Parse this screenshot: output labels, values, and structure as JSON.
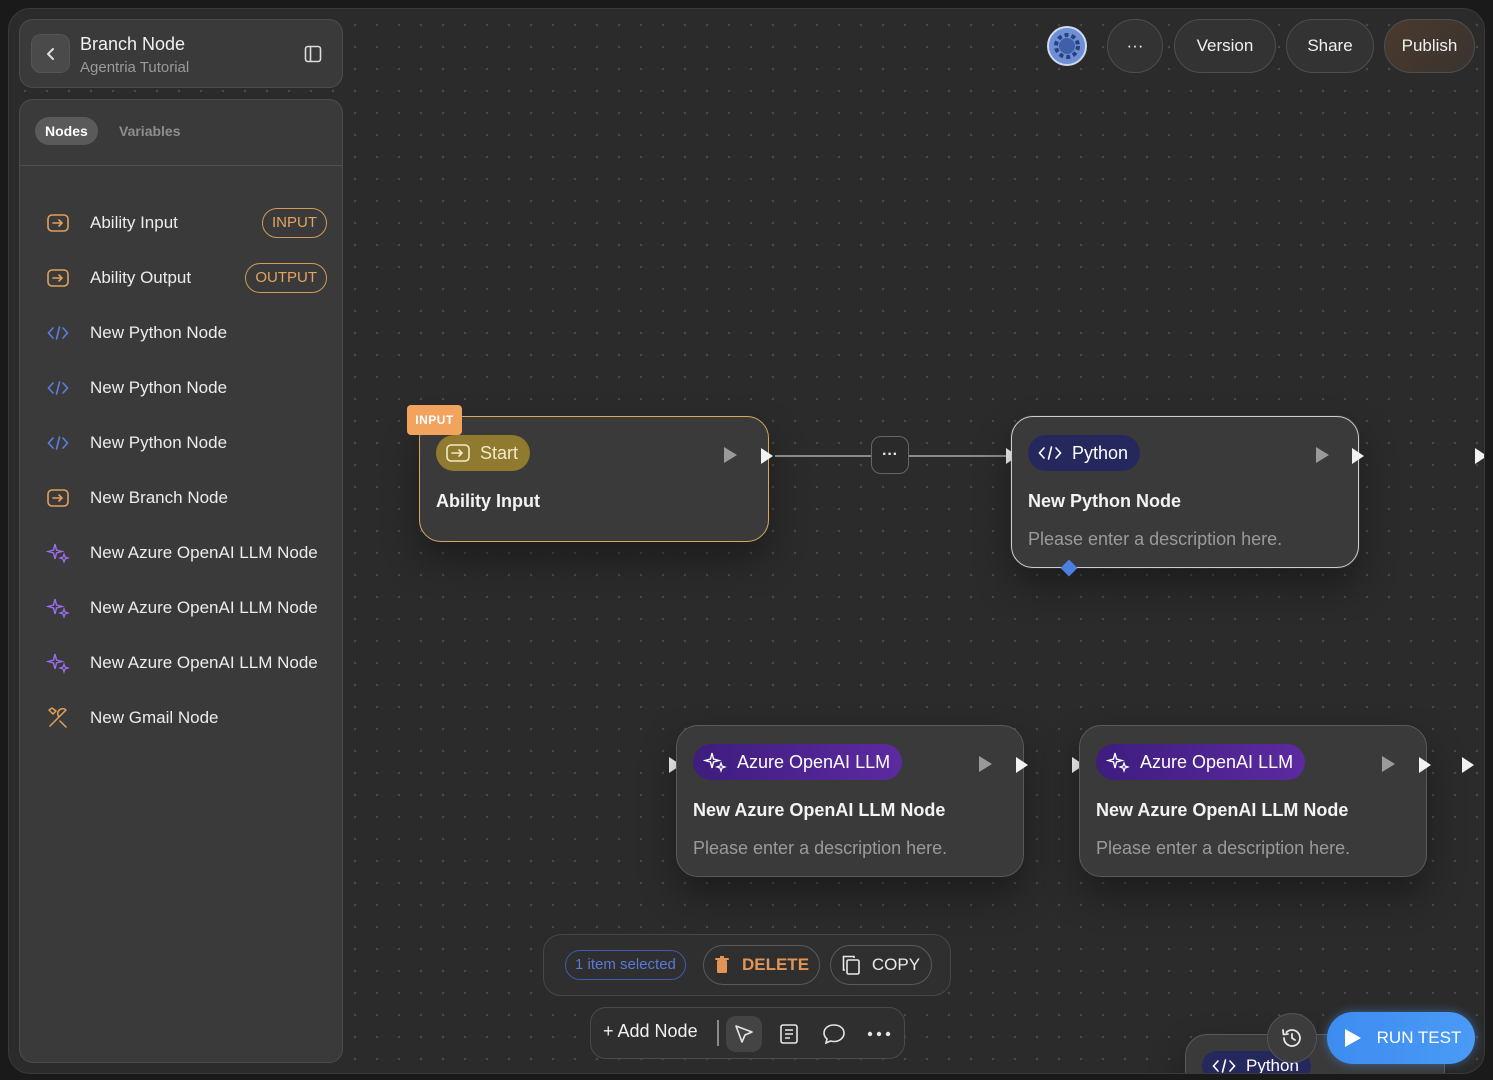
{
  "header": {
    "title": "Branch Node",
    "subtitle": "Agentria Tutorial"
  },
  "sidebar": {
    "tabs": [
      {
        "label": "Nodes",
        "active": true
      },
      {
        "label": "Variables",
        "active": false
      }
    ],
    "items": [
      {
        "label": "Ability Input",
        "icon": "input-icon",
        "tag": "INPUT"
      },
      {
        "label": "Ability Output",
        "icon": "output-icon",
        "tag": "OUTPUT"
      },
      {
        "label": "New Python Node",
        "icon": "code-icon"
      },
      {
        "label": "New Python Node",
        "icon": "code-icon"
      },
      {
        "label": "New Python Node",
        "icon": "code-icon"
      },
      {
        "label": "New Branch Node",
        "icon": "branch-icon"
      },
      {
        "label": "New Azure OpenAI LLM Node",
        "icon": "sparkle-icon"
      },
      {
        "label": "New Azure OpenAI LLM Node",
        "icon": "sparkle-icon"
      },
      {
        "label": "New Azure OpenAI LLM Node",
        "icon": "sparkle-icon"
      },
      {
        "label": "New Gmail Node",
        "icon": "tools-icon"
      }
    ]
  },
  "toolbar": {
    "more": "···",
    "version": "Version",
    "share": "Share",
    "publish": "Publish"
  },
  "canvas": {
    "start_node": {
      "badge": "INPUT",
      "pill": "Start",
      "title": "Ability Input"
    },
    "python_node": {
      "pill": "Python",
      "title": "New Python Node",
      "description": "Please enter a description here."
    },
    "llm_nodes": [
      {
        "pill": "Azure OpenAI LLM",
        "title": "New Azure OpenAI LLM Node",
        "description": "Please enter a description here."
      },
      {
        "pill": "Azure OpenAI LLM",
        "title": "New Azure OpenAI LLM Node",
        "description": "Please enter a description here."
      }
    ],
    "edge_menu": "···",
    "partial_node_pill": "Python"
  },
  "selection": {
    "count": "1 item selected",
    "delete": "DELETE",
    "copy": "COPY"
  },
  "bottom": {
    "add_node": "+ Add Node",
    "run_test": "RUN TEST"
  },
  "colors": {
    "accent_blue": "#4a9af6",
    "input_orange": "#f2a35e",
    "python_pill": "#25285c",
    "llm_pill": "#5d2aa0"
  }
}
